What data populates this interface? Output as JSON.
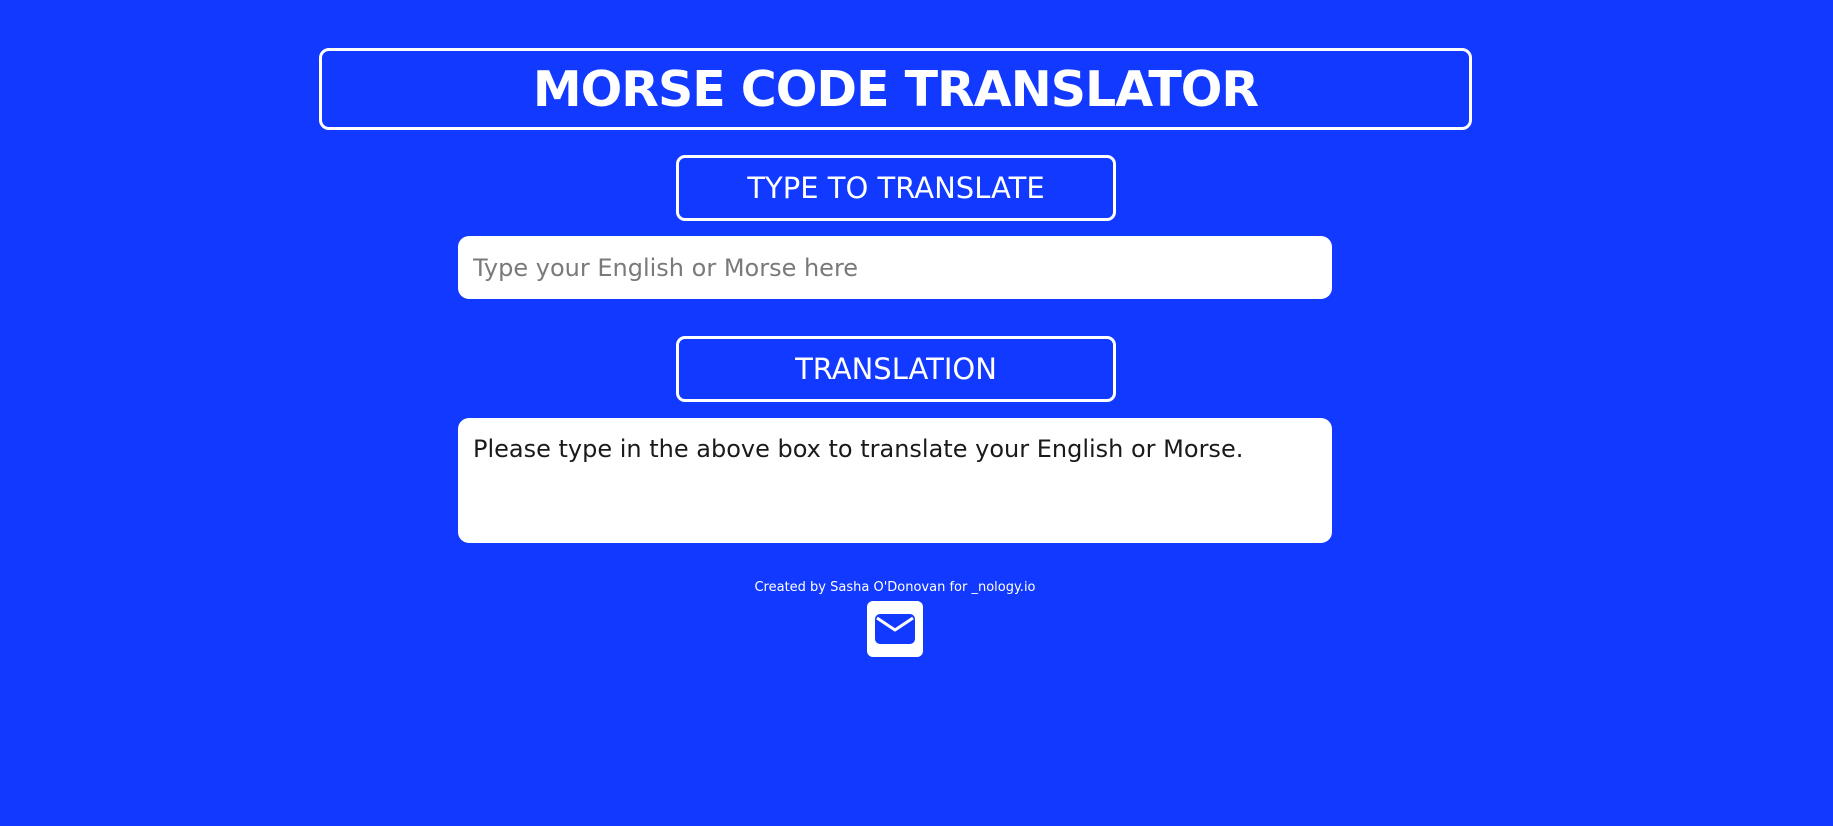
{
  "header": {
    "title": "MORSE CODE TRANSLATOR"
  },
  "input_section": {
    "label": "TYPE TO TRANSLATE",
    "placeholder": "Type your English or Morse here",
    "value": ""
  },
  "output_section": {
    "label": "TRANSLATION",
    "text": "Please type in the above box to translate your English or Morse."
  },
  "footer": {
    "credit": "Created by Sasha O'Donovan for _nology.io",
    "mail_icon": "envelope-icon"
  },
  "colors": {
    "background": "#1239ff",
    "panel": "#ffffff",
    "text_on_background": "#ffffff"
  }
}
